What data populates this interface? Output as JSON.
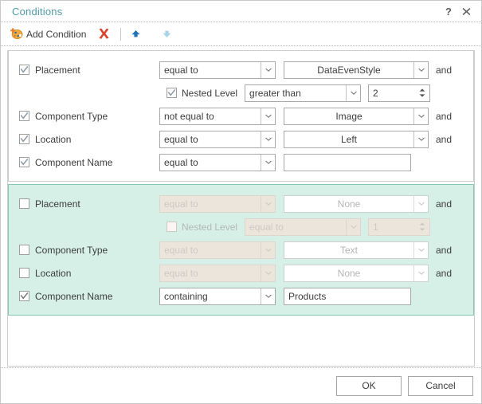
{
  "window": {
    "title": "Conditions",
    "help_icon": "question-mark-icon",
    "close_icon": "close-icon"
  },
  "toolbar": {
    "add_condition_label": "Add Condition",
    "add_condition_icon": "add-condition-icon",
    "delete_icon": "delete-x-icon",
    "move_up_icon": "arrow-up-icon",
    "move_down_icon": "arrow-down-icon"
  },
  "labels": {
    "placement": "Placement",
    "nested_level": "Nested Level",
    "component_type": "Component Type",
    "location": "Location",
    "component_name": "Component Name",
    "and": "and"
  },
  "groups": [
    {
      "id": "condition-group-1",
      "selected": false,
      "rows": [
        {
          "name": "placement",
          "checked": true,
          "enabled": true,
          "operator": "equal to",
          "value": "DataEvenStyle",
          "conjunction": "and"
        },
        {
          "name": "nested-level",
          "checked": true,
          "enabled": true,
          "operator": "greater than",
          "value": "2",
          "conjunction": ""
        },
        {
          "name": "component-type",
          "checked": true,
          "enabled": true,
          "operator": "not equal to",
          "value": "Image",
          "conjunction": "and"
        },
        {
          "name": "location",
          "checked": true,
          "enabled": true,
          "operator": "equal to",
          "value": "Left",
          "conjunction": "and"
        },
        {
          "name": "component-name",
          "checked": true,
          "enabled": true,
          "operator": "equal to",
          "value": "",
          "conjunction": ""
        }
      ]
    },
    {
      "id": "condition-group-2",
      "selected": true,
      "rows": [
        {
          "name": "placement",
          "checked": false,
          "enabled": false,
          "operator": "equal to",
          "value": "None",
          "conjunction": "and"
        },
        {
          "name": "nested-level",
          "checked": false,
          "enabled": false,
          "operator": "equal to",
          "value": "1",
          "conjunction": ""
        },
        {
          "name": "component-type",
          "checked": false,
          "enabled": false,
          "operator": "equal to",
          "value": "Text",
          "conjunction": "and"
        },
        {
          "name": "location",
          "checked": false,
          "enabled": false,
          "operator": "equal to",
          "value": "None",
          "conjunction": "and"
        },
        {
          "name": "component-name",
          "checked": true,
          "enabled": true,
          "operator": "containing",
          "value": "Products",
          "conjunction": ""
        }
      ]
    }
  ],
  "footer": {
    "ok_label": "OK",
    "cancel_label": "Cancel"
  },
  "colors": {
    "title_accent": "#4f9aa8",
    "selected_group_bg": "#d6f0e8",
    "selected_group_border": "#86c7b8",
    "delete_icon": "#d9442b",
    "arrow_enabled": "#1f72b5",
    "arrow_disabled": "#a8d4ea"
  }
}
